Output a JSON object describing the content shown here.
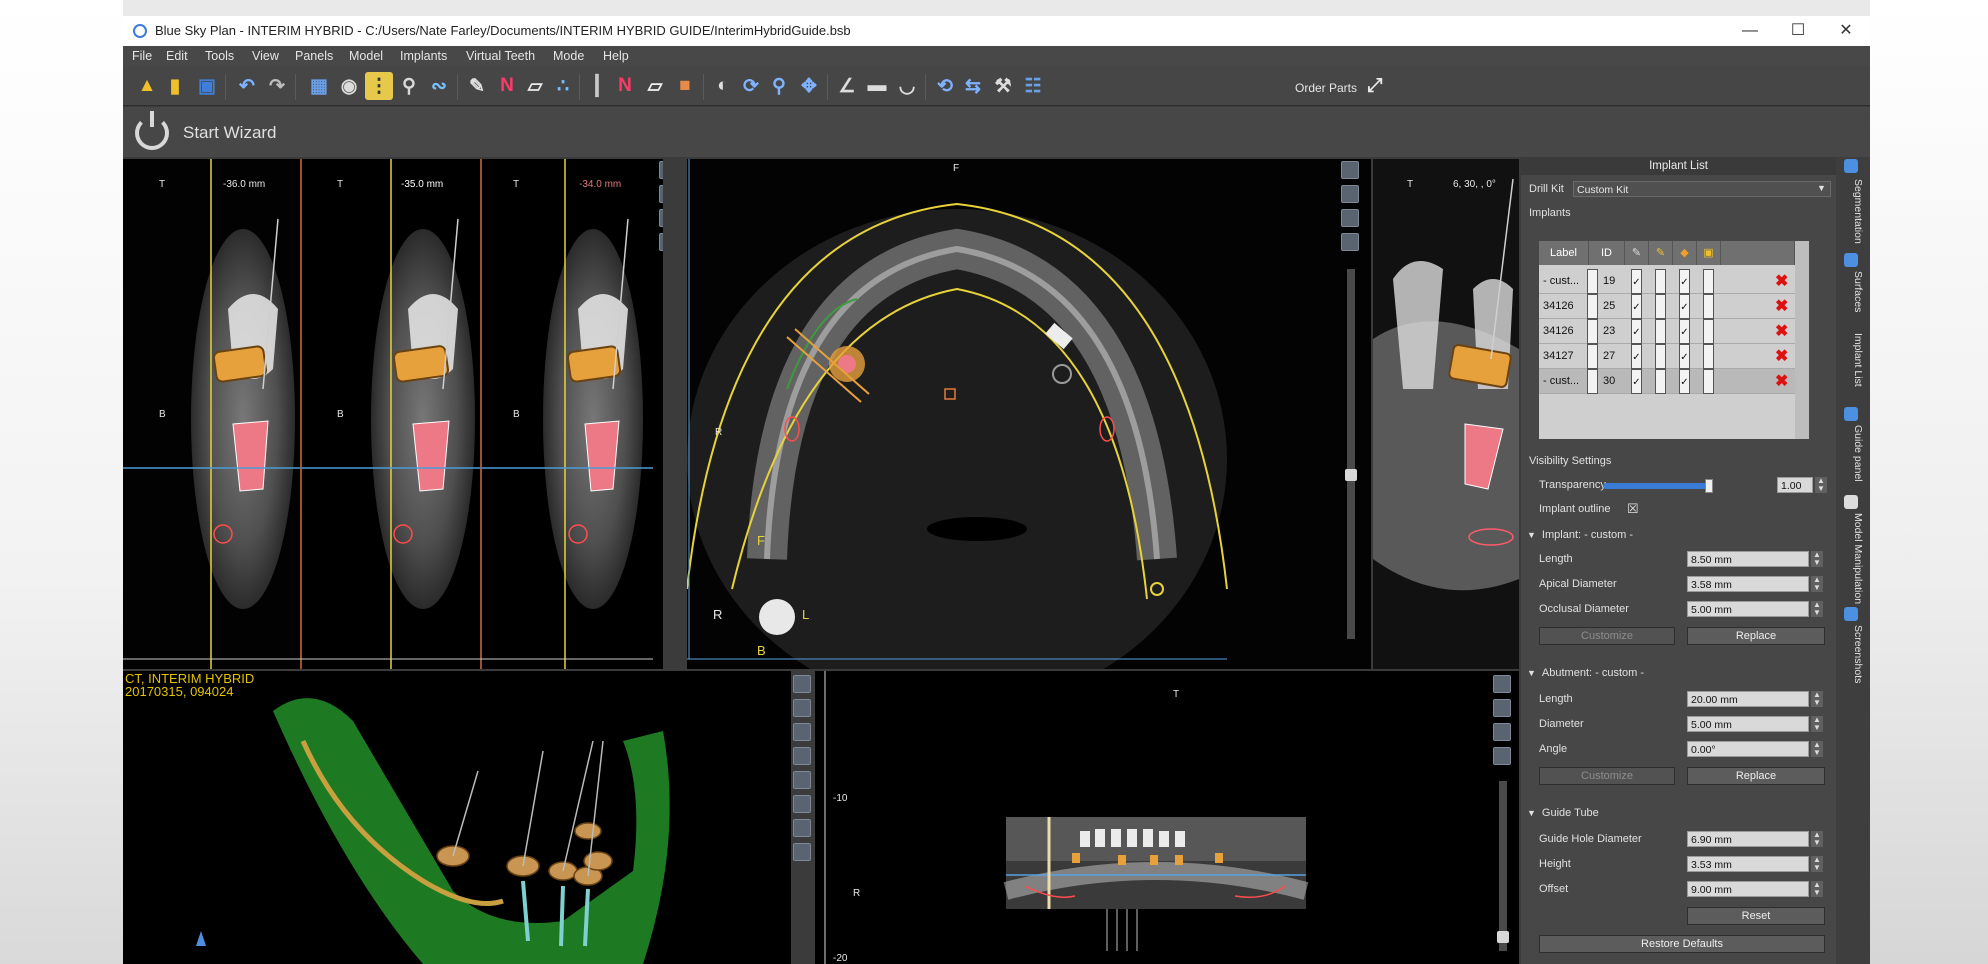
{
  "window": {
    "title": "Blue Sky Plan - INTERIM HYBRID - C:/Users/Nate Farley/Documents/INTERIM HYBRID GUIDE/InterimHybridGuide.bsb",
    "minimize": "—",
    "maximize": "☐",
    "close": "✕"
  },
  "menu": [
    "File",
    "Edit",
    "Tools",
    "View",
    "Panels",
    "Model",
    "Implants",
    "Virtual Teeth",
    "Mode",
    "Help"
  ],
  "toolbar": {
    "order_parts": "Order Parts",
    "icons": [
      "open-folder-icon",
      "folder-dropdown-icon",
      "save-icon",
      "undo-icon",
      "redo-icon",
      "grid-icon",
      "camera-icon",
      "panoramic-icon",
      "search-icon",
      "curve-icon",
      "pen-icon",
      "nerve-icon",
      "tooth-icon",
      "dots-icon",
      "implant-icon",
      "nerve-draw-icon",
      "tooth-single-icon",
      "teeth-color-icon",
      "contrast-icon",
      "rotate-icon",
      "zoom-icon",
      "pan-icon",
      "measure-angle-icon",
      "ruler-icon",
      "protractor-icon",
      "spin-icon",
      "swap-icon",
      "wrench-icon",
      "cart-icon",
      "expand-icon"
    ]
  },
  "wizard": {
    "label": "Start Wizard"
  },
  "views": {
    "cross": [
      {
        "top": "T",
        "mm": "-36.0 mm",
        "b": "B",
        "mmcolor": "#e8e8e8"
      },
      {
        "top": "T",
        "mm": "-35.0 mm",
        "b": "B",
        "mmcolor": "#ffffff"
      },
      {
        "top": "T",
        "mm": "-34.0 mm",
        "b": "B",
        "mmcolor": "#e27a7a"
      }
    ],
    "axial": {
      "top": "F",
      "r": "R",
      "l": "L",
      "b": "B",
      "f2": "F",
      "r2": "R"
    },
    "tangential": {
      "top": "T",
      "angle": "6, 30, , 0°"
    },
    "volume": {
      "line1": "CT, INTERIM HYBRID",
      "line2": "20170315, 094024"
    },
    "pano": {
      "top": "T",
      "side": "R",
      "tick1": "-10",
      "tick2": "-20"
    }
  },
  "panel": {
    "title": "Implant List",
    "drill_kit_label": "Drill Kit",
    "drill_kit_value": "Custom Kit",
    "implants_label": "Implants",
    "table": {
      "headers": [
        "Label",
        "ID"
      ],
      "header_icons": [
        "pencil-icon",
        "brush-icon",
        "diamond-icon",
        "lock-icon"
      ],
      "rows": [
        {
          "label": "- cust...",
          "id": "19",
          "checks": [
            true,
            false,
            true,
            false
          ]
        },
        {
          "label": "34126",
          "id": "25",
          "checks": [
            true,
            false,
            true,
            false
          ]
        },
        {
          "label": "34126",
          "id": "23",
          "checks": [
            true,
            false,
            true,
            false
          ]
        },
        {
          "label": "34127",
          "id": "27",
          "checks": [
            true,
            false,
            true,
            false
          ]
        },
        {
          "label": "- cust...",
          "id": "30",
          "checks": [
            true,
            false,
            true,
            false
          ]
        }
      ]
    },
    "visibility": {
      "label": "Visibility Settings",
      "transparency_label": "Transparency",
      "transparency_value": "1.00",
      "transparency_level": 1.0,
      "outline_label": "Implant outline",
      "outline_checked": "☒"
    },
    "implant": {
      "section": "Implant: - custom -",
      "fields": [
        {
          "label": "Length",
          "value": "8.50 mm"
        },
        {
          "label": "Apical Diameter",
          "value": "3.58 mm"
        },
        {
          "label": "Occlusal Diameter",
          "value": "5.00 mm"
        }
      ],
      "customize": "Customize",
      "replace": "Replace"
    },
    "abutment": {
      "section": "Abutment: - custom -",
      "fields": [
        {
          "label": "Length",
          "value": "20.00 mm"
        },
        {
          "label": "Diameter",
          "value": "5.00 mm"
        },
        {
          "label": "Angle",
          "value": "0.00°"
        }
      ],
      "customize": "Customize",
      "replace": "Replace"
    },
    "guide_tube": {
      "section": "Guide Tube",
      "fields": [
        {
          "label": "Guide Hole Diameter",
          "value": "6.90 mm"
        },
        {
          "label": "Height",
          "value": "3.53 mm"
        },
        {
          "label": "Offset",
          "value": "9.00 mm"
        }
      ],
      "reset": "Reset",
      "restore": "Restore Defaults"
    }
  },
  "sidetabs": [
    "Segmentation",
    "Surfaces",
    "Implant List",
    "Guide panel",
    "Model Manipulation",
    "Screenshots"
  ]
}
